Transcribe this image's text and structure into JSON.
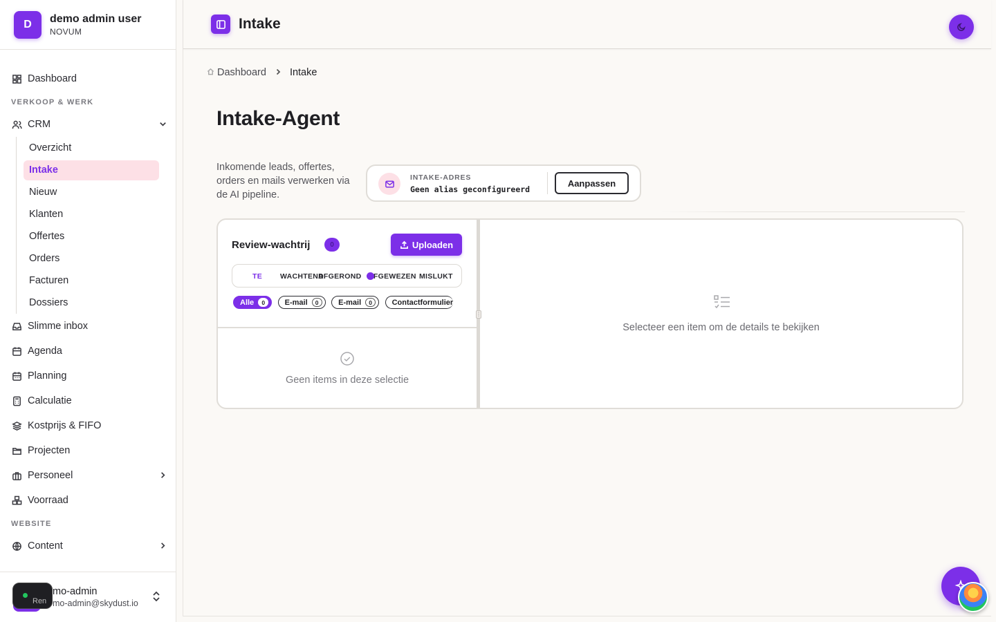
{
  "user": {
    "initial": "D",
    "name": "demo admin user",
    "org": "NOVUM"
  },
  "nav": {
    "dashboard": "Dashboard",
    "section_sales": "VERKOOP & WERK",
    "crm": "CRM",
    "crm_items": [
      "Overzicht",
      "Intake",
      "Nieuw",
      "Klanten",
      "Offertes",
      "Orders",
      "Facturen",
      "Dossiers"
    ],
    "smart_inbox": "Slimme inbox",
    "agenda": "Agenda",
    "planning": "Planning",
    "calculation": "Calculatie",
    "cost_fifo": "Kostprijs & FIFO",
    "projects": "Projecten",
    "staff": "Personeel",
    "stock": "Voorraad",
    "section_website": "WEBSITE",
    "content": "Content"
  },
  "footer": {
    "pill_label": "Ren",
    "name": "mo-admin",
    "email": "mo-admin@skydust.io"
  },
  "topbar": {
    "title": "Intake"
  },
  "breadcrumb": {
    "home": "Dashboard",
    "current": "Intake"
  },
  "page": {
    "title": "Intake-Agent",
    "description": "Inkomende leads, offertes, orders en mails verwerken via de AI pipeline."
  },
  "intake": {
    "label": "INTAKE-ADRES",
    "value": "Geen alias geconfigureerd",
    "adjust_label": "Aanpassen"
  },
  "queue": {
    "title": "Review-wachtrij",
    "count": "0",
    "upload_label": "Uploaden",
    "tabs": [
      "TE",
      "WACHTEND",
      "AFGEROND",
      "AFGEWEZEN",
      "MISLUKT"
    ],
    "tab_badge": "0",
    "chips": [
      {
        "label": "Alle",
        "count": "0"
      },
      {
        "label": "E-mail",
        "count": "0"
      },
      {
        "label": "E-mail",
        "count": "0"
      },
      {
        "label": "Contactformulier",
        "count": ""
      }
    ],
    "empty_text": "Geen items in deze selectie"
  },
  "detail": {
    "empty_text": "Selecteer een item om de details te bekijken"
  },
  "colors": {
    "accent": "#7c2fe8",
    "active_bg": "#fde0e6",
    "background": "#fbf9f6"
  }
}
